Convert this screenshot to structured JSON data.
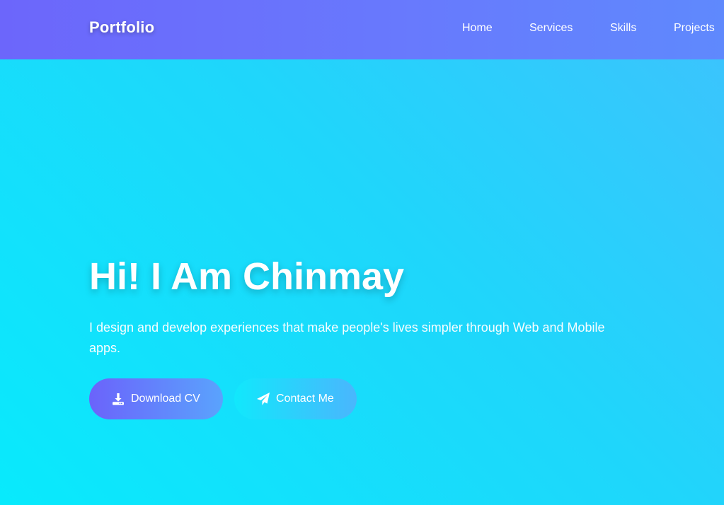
{
  "nav": {
    "brand": "Portfolio",
    "links": [
      {
        "label": "Home"
      },
      {
        "label": "Services"
      },
      {
        "label": "Skills"
      },
      {
        "label": "Projects"
      }
    ]
  },
  "hero": {
    "title": "Hi! I Am Chinmay",
    "subtitle": "I design and develop experiences that make people's lives simpler through Web and Mobile apps.",
    "buttons": {
      "download": {
        "label": "Download CV",
        "icon": "download-icon"
      },
      "contact": {
        "label": "Contact Me",
        "icon": "paper-plane-icon"
      }
    }
  },
  "colors": {
    "navbar": "#6879fd",
    "hero_background": "#1fd6fb",
    "primary_button": "#6b63fb",
    "secondary_button": "#11e8fc",
    "text": "#ffffff"
  }
}
